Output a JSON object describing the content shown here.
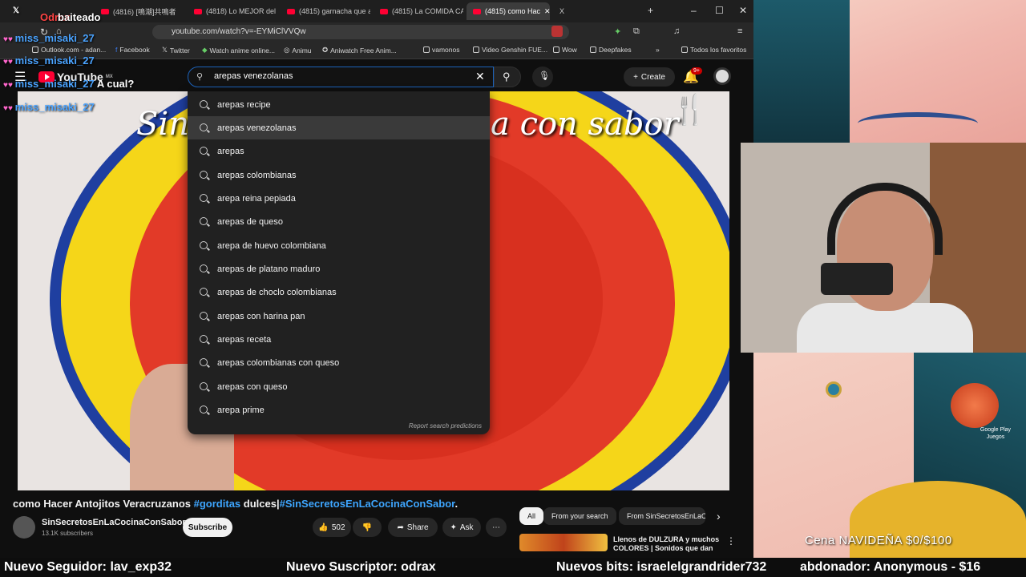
{
  "browser": {
    "tabs": [
      "(4816) [鳴潮]共鳴者",
      "(4818) Lo MEJOR del",
      "(4815) garnacha que a",
      "(4815) La COMIDA CA",
      "(4815) como Hac",
      "X"
    ],
    "url": "youtube.com/watch?v=-EYMiClVVQw",
    "bookmarks": [
      "Outlook.com - adan...",
      "Facebook",
      "Twitter",
      "Watch anime online...",
      "Animu",
      "Aniwatch Free Anim...",
      "vamonos",
      "Video Genshin FUE...",
      "Wow",
      "Deepfakes",
      "Todos los favoritos"
    ]
  },
  "youtube": {
    "logo": "YouTube",
    "logo_region": "MX",
    "search_value": "arepas venezolanas",
    "create_label": "Create",
    "notif_badge": "9+",
    "suggestions": [
      "arepas recipe",
      "arepas venezolanas",
      "arepas",
      "arepas colombianas",
      "arepa reina pepiada",
      "arepas de queso",
      "arepa de huevo colombiana",
      "arepas de platano maduro",
      "arepas de choclo colombianas",
      "arepas con harina pan",
      "arepas receta",
      "arepas colombianas con queso",
      "arepas con queso",
      "arepa prime"
    ],
    "report_label": "Report search predictions",
    "video_overlay_left": "Sin",
    "video_overlay_right": "a con sabor",
    "video_title_plain": "como Hacer Antojitos Veracruzanos ",
    "video_title_tag1": "#gorditas",
    "video_title_mid": " dulces|",
    "video_title_tag2": "#SinSecretosEnLaCocinaConSabor",
    "video_title_end": ".",
    "channel_name": "SinSecretosEnLaCocinaConSabor",
    "channel_subs": "13.1K subscribers",
    "subscribe_label": "Subscribe",
    "likes": "502",
    "share_label": "Share",
    "ask_label": "Ask",
    "chips": [
      "All",
      "From your search",
      "From SinSecretosEnLaC"
    ],
    "rec_title": "Llenos de DULZURA y muchos COLORES | Sonidos que dan"
  },
  "stream": {
    "chat_top_name": "Odrax",
    "chat_top_msg": "baiteado",
    "chat_user": "miss_misaki_27",
    "chat_msg_1": "A cual?",
    "gp_label": "Google Play Juegos",
    "goal_text": "Cena NAVIDEÑA $0/$100",
    "ticker": [
      "Nuevo Seguidor: lav_exp32",
      "Nuevo Suscriptor: odrax",
      "Nuevos bits: israelelgrandrider732",
      "abdonador: Anonymous - $16"
    ]
  },
  "colors": {
    "accent_blue": "#3ea6ff",
    "yt_red": "#ff0033",
    "chat_blue": "#4aa3ff"
  }
}
